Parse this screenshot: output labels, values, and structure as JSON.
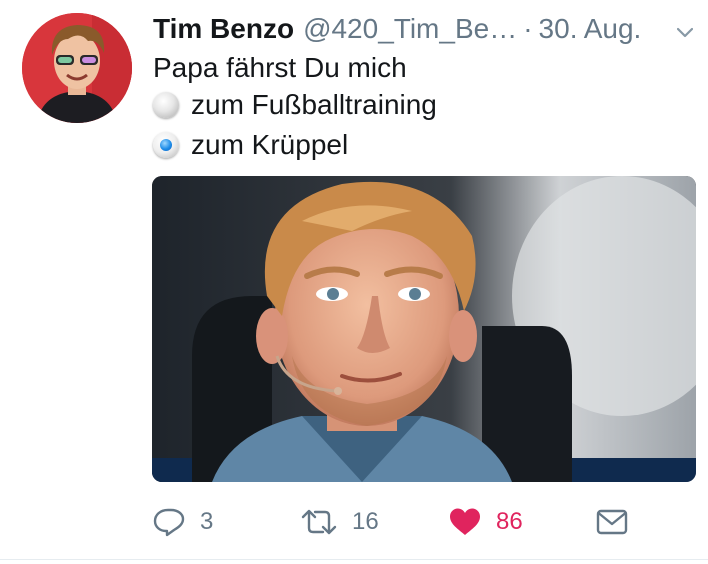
{
  "tweet": {
    "author_name": "Tim Benzo",
    "handle": "@420_Tim_Be…",
    "separator": "·",
    "date": "30. Aug.",
    "text": "Papa fährst Du mich",
    "options": [
      {
        "label": "zum Fußballtraining",
        "selected": false
      },
      {
        "label": "zum Krüppel",
        "selected": true
      }
    ]
  },
  "actions": {
    "reply_count": "3",
    "retweet_count": "16",
    "like_count": "86"
  },
  "colors": {
    "text": "#14171a",
    "secondary": "#657786",
    "like": "#e0245e",
    "radio_selected": "#1e8de8"
  },
  "icons": {
    "reply": "reply-icon",
    "retweet": "retweet-icon",
    "like": "heart-icon",
    "message": "envelope-icon",
    "menu": "chevron-down-icon"
  }
}
